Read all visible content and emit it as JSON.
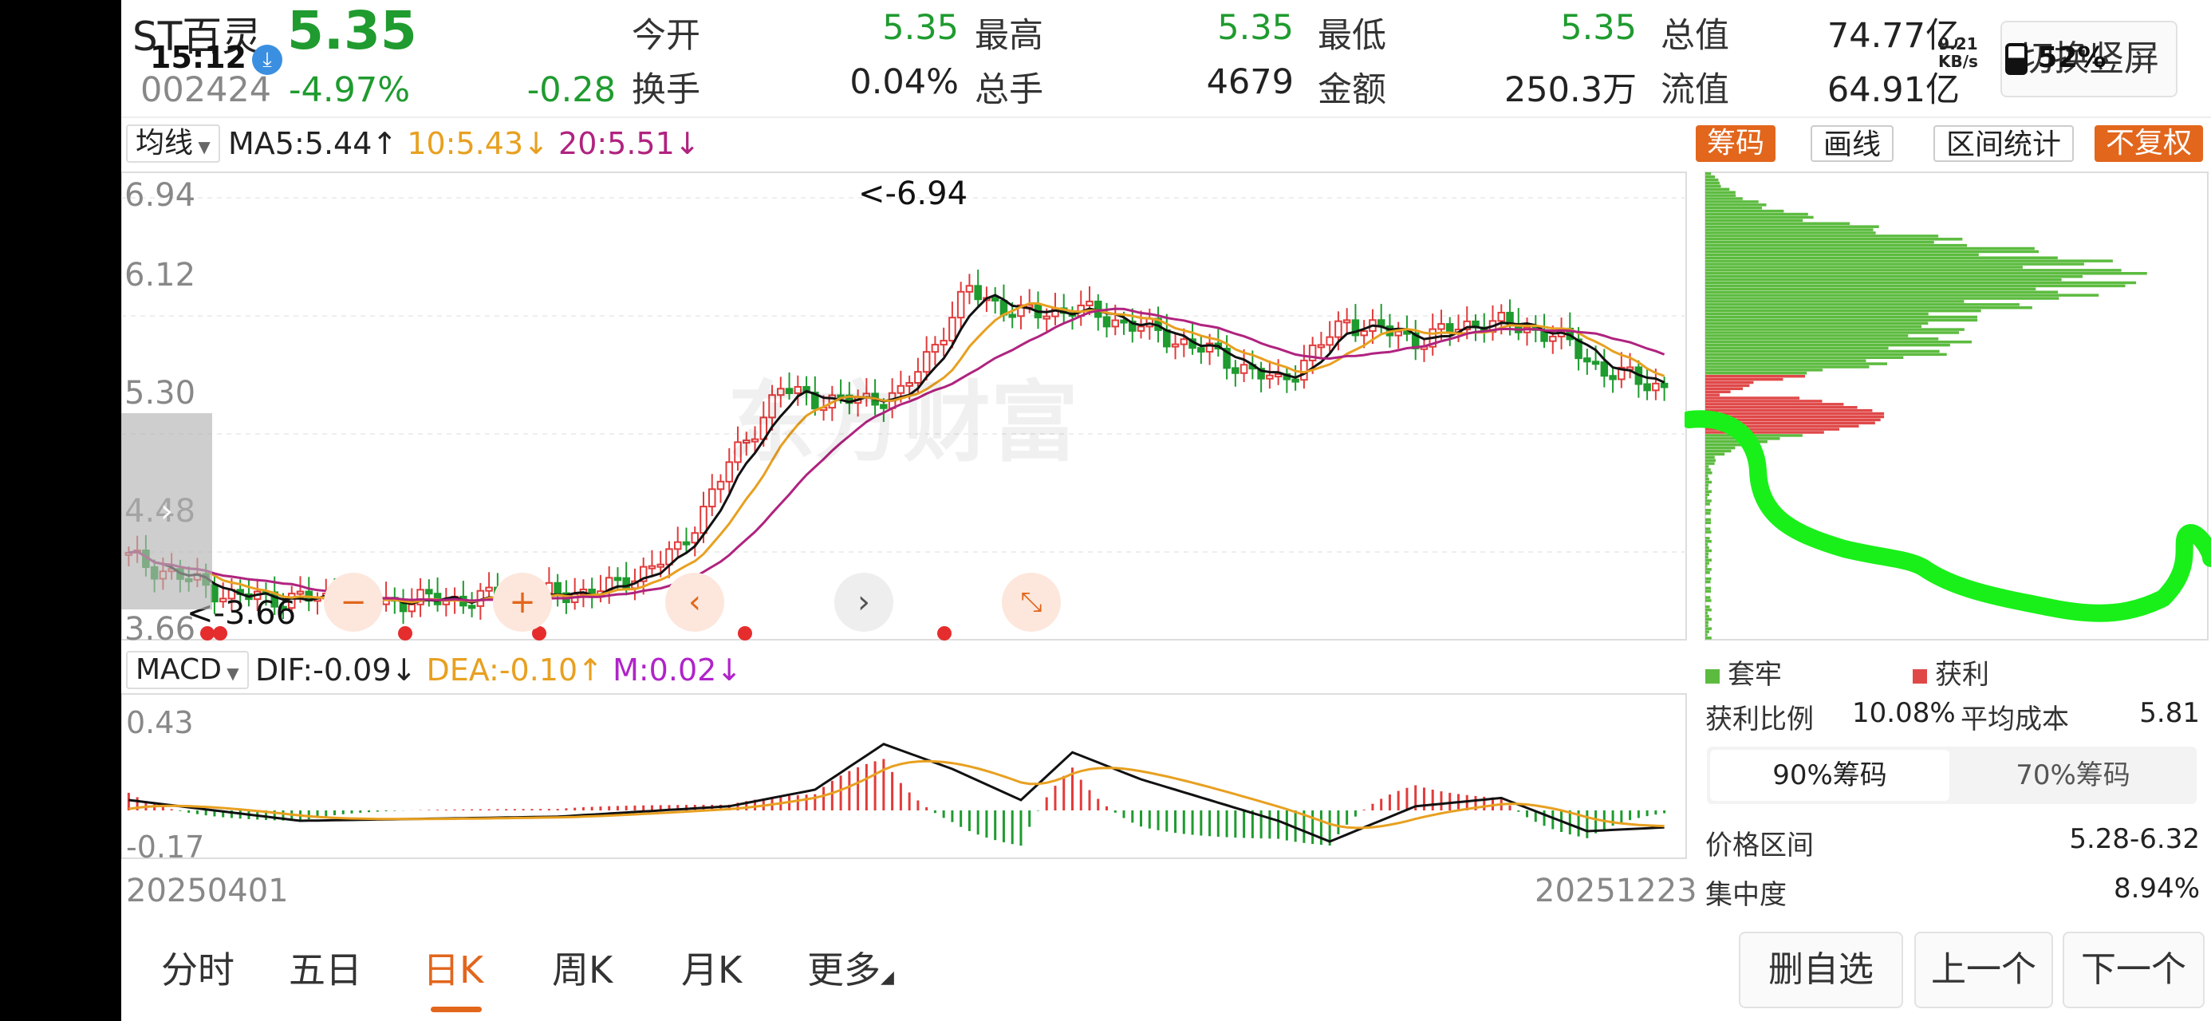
{
  "stock": {
    "name": "ST百灵",
    "price": "5.35",
    "time": "15:12",
    "code": "002424",
    "change_pct": "-4.97%",
    "change": "-0.28"
  },
  "stats": [
    {
      "label": "今开",
      "value": "5.35",
      "color": "green"
    },
    {
      "label": "最高",
      "value": "5.35",
      "color": "green"
    },
    {
      "label": "最低",
      "value": "5.35",
      "color": "green"
    },
    {
      "label": "总值",
      "value": "74.77亿",
      "color": "dark"
    },
    {
      "label": "换手",
      "value": "0.04%",
      "color": "dark"
    },
    {
      "label": "总手",
      "value": "4679",
      "color": "dark"
    },
    {
      "label": "金额",
      "value": "250.3万",
      "color": "dark"
    },
    {
      "label": "流值",
      "value": "64.91亿",
      "color": "dark"
    }
  ],
  "status": {
    "net_speed": "9.21",
    "net_unit": "KB/s",
    "battery": "52%"
  },
  "switch_label": "切换竖屏",
  "ma": {
    "selector": "均线",
    "ma5": "MA5:5.44↑",
    "ma10": "10:5.43↓",
    "ma20": "20:5.51↓"
  },
  "tools": {
    "chips": "筹码",
    "draw": "画线",
    "range": "区间统计",
    "adjust": "不复权"
  },
  "kline": {
    "y_ticks": [
      "6.94",
      "6.12",
      "5.30",
      "4.48",
      "3.66"
    ],
    "high_label": "<-6.94",
    "low_label": "<-3.66",
    "watermark": "东方财富"
  },
  "macd": {
    "selector": "MACD",
    "dif": "DIF:-0.09↓",
    "dea": "DEA:-0.10↑",
    "m": "M:0.02↓",
    "y_ticks": [
      "0.43",
      "-0.17"
    ]
  },
  "dates": {
    "start": "20250401",
    "end": "20251223"
  },
  "chips": {
    "legend_trapped": "套牢",
    "legend_profit": "获利",
    "profit_ratio_label": "获利比例",
    "profit_ratio": "10.08%",
    "avg_cost_label": "平均成本",
    "avg_cost": "5.81",
    "tab_90": "90%筹码",
    "tab_70": "70%筹码",
    "price_range_label": "价格区间",
    "price_range": "5.28-6.32",
    "concentration_label": "集中度",
    "concentration": "8.94%"
  },
  "period_tabs": [
    "分时",
    "五日",
    "日K",
    "周K",
    "月K",
    "更多"
  ],
  "active_tab": "日K",
  "bottom_buttons": {
    "remove": "删自选",
    "prev": "上一个",
    "next": "下一个"
  },
  "colors": {
    "up": "#e23b3b",
    "down": "#1f9b2f",
    "ma5": "#111111",
    "ma10": "#e8a020",
    "ma20": "#b0237f",
    "accent": "#e2661c",
    "chips_green": "#5cbb3f",
    "chips_red": "#e04848",
    "scribble": "#19f019"
  }
}
